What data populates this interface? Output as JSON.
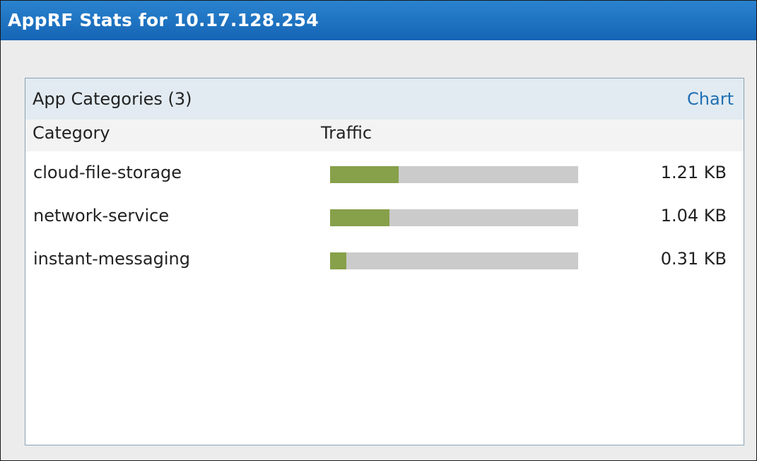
{
  "window": {
    "title": "AppRF Stats for 10.17.128.254"
  },
  "panel": {
    "header": "App Categories (3)",
    "chart_link": "Chart",
    "columns": {
      "category": "Category",
      "traffic": "Traffic"
    },
    "rows": [
      {
        "name": "cloud-file-storage",
        "traffic": "1.21 KB",
        "fraction": 0.275
      },
      {
        "name": "network-service",
        "traffic": "1.04 KB",
        "fraction": 0.24
      },
      {
        "name": "instant-messaging",
        "traffic": "0.31 KB",
        "fraction": 0.066
      }
    ]
  },
  "colors": {
    "titlebar": "#1f74c4",
    "bar_fill": "#87a04a",
    "bar_track": "#cbcbcb",
    "link": "#1f6fb4"
  }
}
